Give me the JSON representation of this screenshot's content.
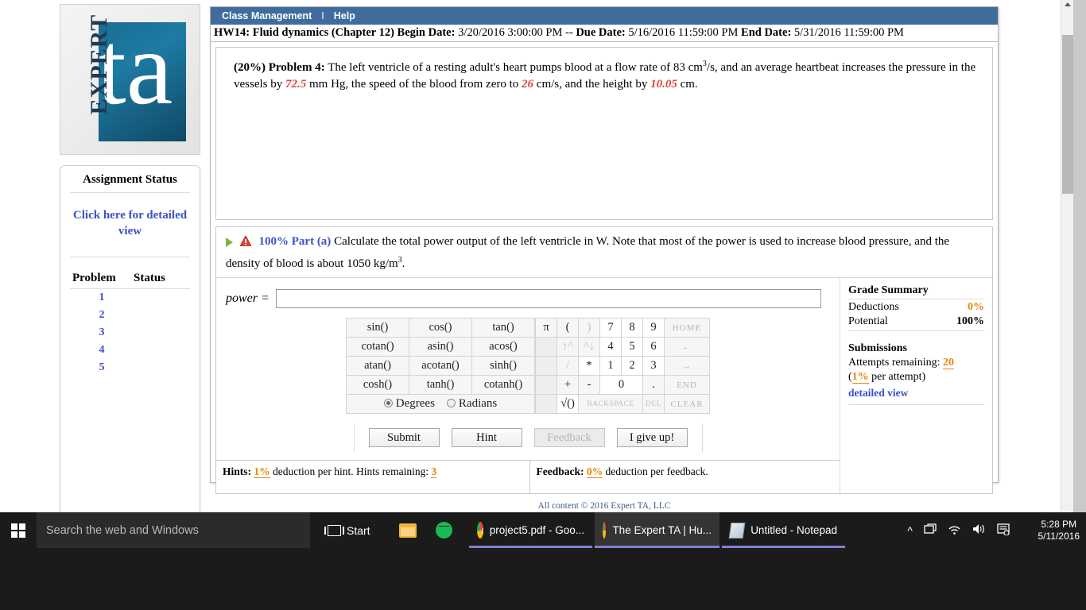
{
  "logo": {
    "word": "EXPERT",
    "mark": "ta"
  },
  "sidebar": {
    "title": "Assignment Status",
    "detailed_link": "Click here for detailed view",
    "columns": {
      "problem": "Problem",
      "status": "Status"
    },
    "rows": [
      {
        "num": "1",
        "status": ""
      },
      {
        "num": "2",
        "status": ""
      },
      {
        "num": "3",
        "status": ""
      },
      {
        "num": "4",
        "status": ""
      },
      {
        "num": "5",
        "status": ""
      }
    ]
  },
  "menubar": {
    "class_management": "Class Management",
    "separator": "I",
    "help": "Help"
  },
  "assignment": {
    "title": "HW14: Fluid dynamics (Chapter 12)",
    "begin_label": "Begin Date:",
    "begin_value": "3/20/2016 3:00:00 PM",
    "dash": "--",
    "due_label": "Due Date:",
    "due_value": "5/16/2016 11:59:00 PM",
    "end_label": "End Date:",
    "end_value": "5/31/2016 11:59:00 PM"
  },
  "problem": {
    "weight": "(20%)",
    "label": "Problem 4:",
    "line1_a": "The left ventricle of a resting adult's heart pumps blood at a flow rate of 83 cm",
    "line1_sup": "3",
    "line1_b": "/s, and an average heartbeat",
    "line2_a": "increases the pressure in the vessels by",
    "v_pressure": "72.5",
    "line2_b": "mm Hg, the speed of the blood from zero to",
    "v_speed": "26",
    "line2_c": "cm/s, and the height by",
    "v_height": "10.05",
    "line2_d": "cm."
  },
  "part": {
    "percent": "100%",
    "name": "Part (a)",
    "text_a": "Calculate the total power output of the left ventricle in W. Note that most of the power is used to increase blood pressure,",
    "text_b": "and the density of blood is about 1050 kg/m",
    "text_sup": "3",
    "text_c": "."
  },
  "answer": {
    "label": "power =",
    "value": "",
    "placeholder": ""
  },
  "keypad": {
    "functions": [
      [
        "sin()",
        "cos()",
        "tan()"
      ],
      [
        "cotan()",
        "asin()",
        "acos()"
      ],
      [
        "atan()",
        "acotan()",
        "sinh()"
      ],
      [
        "cosh()",
        "tanh()",
        "cotanh()"
      ]
    ],
    "angle_modes": [
      {
        "label": "Degrees",
        "selected": true
      },
      {
        "label": "Radians",
        "selected": false
      }
    ],
    "numeric": {
      "r1": [
        "π",
        "(",
        ")",
        "7",
        "8",
        "9",
        "HOME"
      ],
      "r2": [
        "",
        "↑^",
        "^↓",
        "4",
        "5",
        "6",
        "←"
      ],
      "r3": [
        "",
        "/",
        "*",
        "1",
        "2",
        "3",
        "→"
      ],
      "r4": [
        "",
        "+",
        "-",
        "0",
        ".",
        "END"
      ],
      "r5": [
        "",
        "√()",
        "BACKSPACE",
        "DEL",
        "CLEAR"
      ]
    }
  },
  "actions": {
    "submit": "Submit",
    "hint": "Hint",
    "feedback": "Feedback",
    "give_up": "I give up!"
  },
  "hints_strip": {
    "hints_label": "Hints:",
    "hints_pct": "1%",
    "hints_text": "deduction per hint. Hints remaining:",
    "hints_remaining": "3",
    "feedback_label": "Feedback:",
    "feedback_pct": "0%",
    "feedback_text": "deduction per feedback."
  },
  "grade_summary": {
    "title": "Grade Summary",
    "deductions_label": "Deductions",
    "deductions_value": "0%",
    "potential_label": "Potential",
    "potential_value": "100%",
    "submissions_title": "Submissions",
    "attempts_label": "Attempts remaining:",
    "attempts_value": "20",
    "per_attempt_open": "(",
    "per_attempt_pct": "1%",
    "per_attempt_text": " per attempt)",
    "detailed_view": "detailed view"
  },
  "footer": {
    "copyright": "All content © 2016 Expert TA, LLC"
  },
  "taskbar": {
    "search_placeholder": "Search the web and Windows",
    "start_label": "Start",
    "apps": [
      {
        "label": "project5.pdf - Goo...",
        "icon": "chrome-icon",
        "active": false
      },
      {
        "label": "The Expert TA | Hu...",
        "icon": "chrome-icon",
        "active": true
      },
      {
        "label": "Untitled - Notepad",
        "icon": "notepad-icon",
        "active": false
      }
    ],
    "tray": [
      "∧",
      "Ὓ",
      "὏6",
      "ὐa",
      "Ὓ9"
    ],
    "time": "5:28 PM",
    "date": "5/11/2016"
  },
  "colors": {
    "menubar": "#3f6c9c",
    "link": "#3a52c8",
    "orange": "#e8870b",
    "red": "#e0443a"
  }
}
